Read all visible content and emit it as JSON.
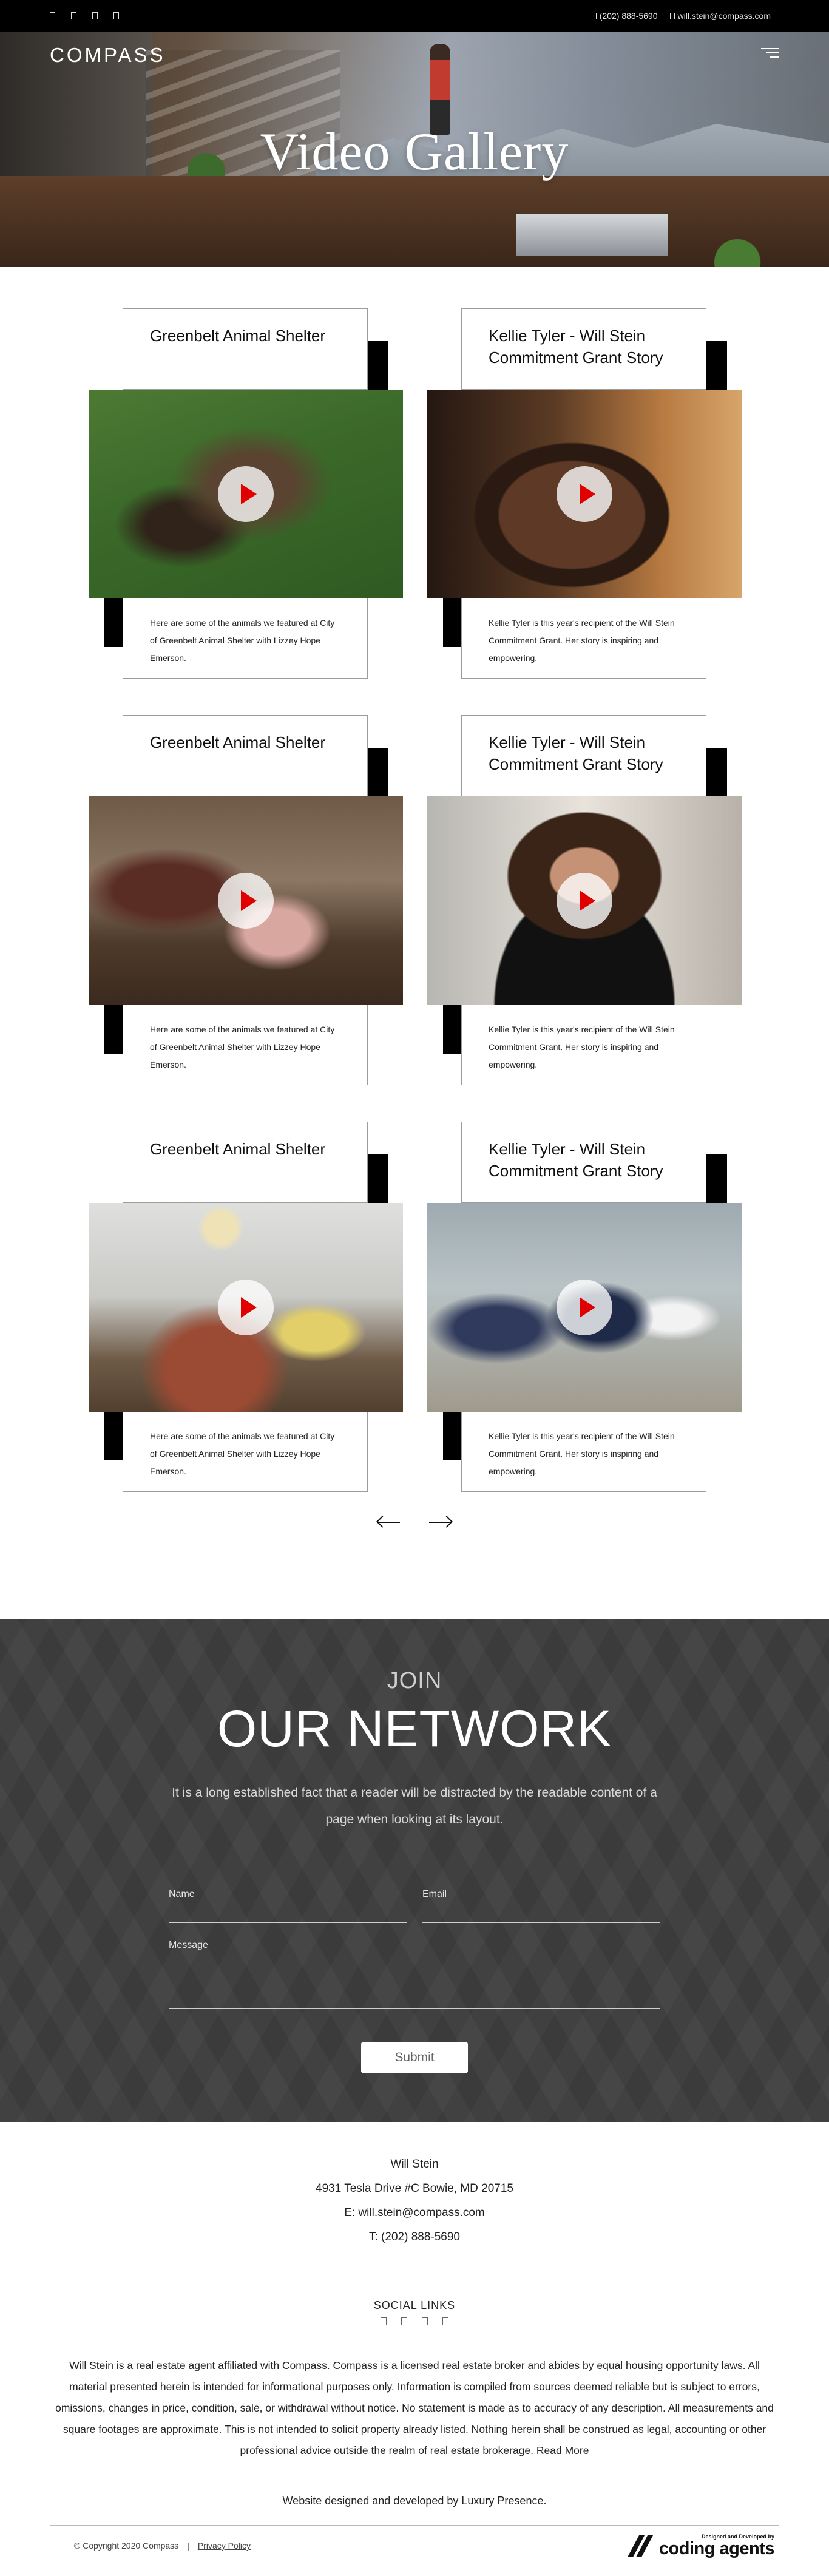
{
  "topbar": {
    "social_icons": [
      "facebook-icon",
      "twitter-icon",
      "instagram-icon",
      "linkedin-icon"
    ],
    "phone": "(202) 888-5690",
    "email": "will.stein@compass.com"
  },
  "header": {
    "logo": "COMPASS",
    "menu_icon": "hamburger-menu-icon"
  },
  "hero": {
    "title": "Video Gallery"
  },
  "gallery": {
    "cards": [
      {
        "title": "Greenbelt Animal Shelter",
        "description": "Here are some of the animals we featured at City of Greenbelt Animal Shelter with Lizzey Hope Emerson.",
        "thumb": "dog-video-thumbnail"
      },
      {
        "title": "Kellie Tyler - Will Stein Commitment Grant Story",
        "description": "Kellie Tyler is this year's recipient of the Will Stein Commitment Grant. Her story is inspiring and empowering.",
        "thumb": "woman-portrait-video-thumbnail"
      },
      {
        "title": "Greenbelt Animal Shelter",
        "description": "Here are some of the animals we featured at City of Greenbelt Animal Shelter with Lizzey Hope Emerson.",
        "thumb": "family-video-thumbnail"
      },
      {
        "title": "Kellie Tyler - Will Stein Commitment Grant Story",
        "description": "Kellie Tyler is this year's recipient of the Will Stein Commitment Grant. Her story is inspiring and empowering.",
        "thumb": "curly-hair-woman-video-thumbnail"
      },
      {
        "title": "Greenbelt Animal Shelter",
        "description": "Here are some of the animals we featured at City of Greenbelt Animal Shelter with Lizzey Hope Emerson.",
        "thumb": "office-group-video-thumbnail"
      },
      {
        "title": "Kellie Tyler - Will Stein Commitment Grant Story",
        "description": "Kellie Tyler is this year's recipient of the Will Stein Commitment Grant. Her story is inspiring and empowering.",
        "thumb": "three-people-video-thumbnail"
      }
    ],
    "play_icon": "play-icon",
    "prev_icon": "arrow-left-icon",
    "next_icon": "arrow-right-icon"
  },
  "network": {
    "kicker": "JOIN",
    "title": "OUR NETWORK",
    "lead": "It is a long established fact that a reader will be distracted by the readable content of a page when looking at its layout.",
    "name_label": "Name",
    "email_label": "Email",
    "message_label": "Message",
    "name_value": "",
    "email_value": "",
    "message_value": "",
    "submit_label": "Submit"
  },
  "footer": {
    "agent_name": "Will Stein",
    "address": "4931 Tesla Drive #C Bowie, MD 20715",
    "email_line": "E: will.stein@compass.com",
    "phone_line": "T: (202) 888-5690",
    "social_heading": "SOCIAL LINKS",
    "social_icons": [
      "facebook-icon",
      "twitter-icon",
      "instagram-icon",
      "linkedin-icon"
    ],
    "disclaimer": "Will Stein is a real estate agent affiliated with Compass. Compass is a licensed real estate broker and abides by equal housing opportunity laws. All material presented herein is intended for informational purposes only. Information is compiled from sources deemed reliable but is subject to errors, omissions, changes in price, condition, sale, or withdrawal without notice. No statement is made as to accuracy of any description. All measurements and square footages are approximate. This is not intended to solicit property already listed. Nothing herein shall be construed as legal, accounting or other professional advice outside the realm of real estate brokerage.",
    "read_more": "Read More",
    "credit": "Website designed and developed by Luxury Presence.",
    "copyright": "© Copyright 2020 Compass",
    "separator": "|",
    "privacy": "Privacy Policy",
    "brand_small_1": "Designed and Developed by",
    "brand_name": "coding agents"
  }
}
